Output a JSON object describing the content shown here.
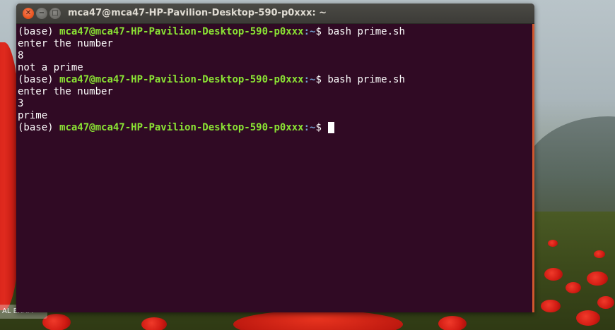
{
  "window": {
    "title": "mca47@mca47-HP-Pavilion-Desktop-590-p0xxx: ~",
    "close_glyph": "✕",
    "min_glyph": "−",
    "max_glyph": "□"
  },
  "terminal": {
    "lines": [
      {
        "type": "prompt",
        "env": "(base) ",
        "user": "mca47@mca47-HP-Pavilion-Desktop-590-p0xxx",
        "path": ":~",
        "sym": "$ ",
        "cmd": "bash prime.sh"
      },
      {
        "type": "out",
        "text": "enter the number"
      },
      {
        "type": "out",
        "text": "8"
      },
      {
        "type": "out",
        "text": "not a prime"
      },
      {
        "type": "prompt",
        "env": "(base) ",
        "user": "mca47@mca47-HP-Pavilion-Desktop-590-p0xxx",
        "path": ":~",
        "sym": "$ ",
        "cmd": "bash prime.sh"
      },
      {
        "type": "out",
        "text": "enter the number"
      },
      {
        "type": "out",
        "text": "3"
      },
      {
        "type": "out",
        "text": "prime"
      },
      {
        "type": "prompt",
        "env": "(base) ",
        "user": "mca47@mca47-HP-Pavilion-Desktop-590-p0xxx",
        "path": ":~",
        "sym": "$ ",
        "cmd": ""
      }
    ]
  },
  "desktop": {
    "partial_label": "AL EXAM"
  },
  "colors": {
    "terminal_bg": "#300a24",
    "user_green": "#8ae234",
    "path_blue": "#729fcf"
  }
}
